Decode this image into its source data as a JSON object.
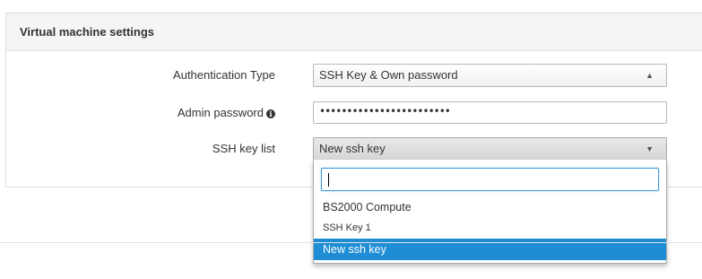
{
  "panel": {
    "title": "Virtual machine settings"
  },
  "form": {
    "auth_type": {
      "label": "Authentication Type",
      "value": "SSH Key & Own password"
    },
    "admin_password": {
      "label": "Admin password",
      "value": "••••••••••••••••••••••••",
      "info_icon": "info-circle-icon"
    },
    "ssh_key_list": {
      "label": "SSH key list",
      "value": "New ssh key",
      "search_value": "",
      "options": [
        "BS2000 Compute",
        "SSH Key 1",
        "New ssh key"
      ],
      "selected_option": "New ssh key"
    }
  },
  "colors": {
    "highlight": "#1f8dd6",
    "focus_border": "#3d9bdc",
    "header_bg": "#f5f5f5"
  }
}
